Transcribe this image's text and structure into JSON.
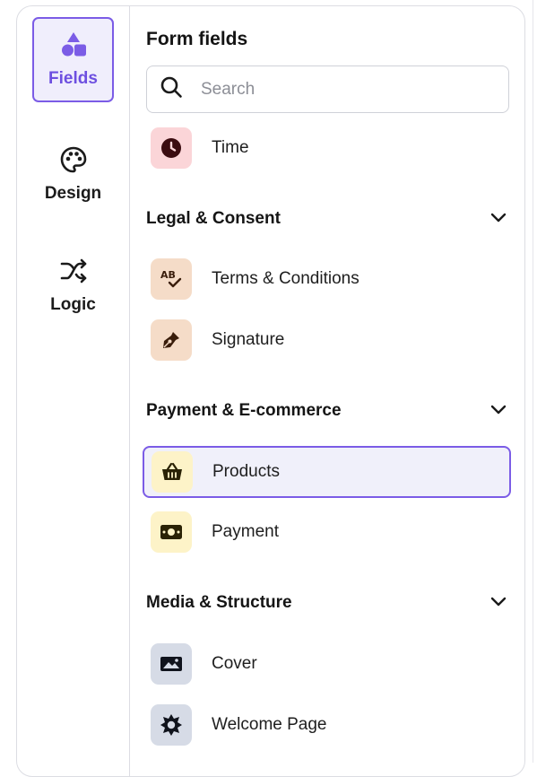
{
  "rail": {
    "items": [
      {
        "label": "Fields",
        "icon": "shapes-icon",
        "active": true
      },
      {
        "label": "Design",
        "icon": "palette-icon",
        "active": false
      },
      {
        "label": "Logic",
        "icon": "shuffle-icon",
        "active": false
      }
    ]
  },
  "panel": {
    "title": "Form fields",
    "search": {
      "placeholder": "Search",
      "value": ""
    }
  },
  "fields": {
    "time": {
      "label": "Time",
      "icon": "clock-icon",
      "color": "#fbd5d8"
    },
    "legal": {
      "title": "Legal & Consent",
      "terms": {
        "label": "Terms & Conditions",
        "icon": "spellcheck-icon",
        "color": "#f5dcc8"
      },
      "signature": {
        "label": "Signature",
        "icon": "pen-nib-icon",
        "color": "#f5dcc8"
      }
    },
    "payment": {
      "title": "Payment & E-commerce",
      "products": {
        "label": "Products",
        "icon": "basket-icon",
        "color": "#fdf3c8"
      },
      "payment": {
        "label": "Payment",
        "icon": "banknote-icon",
        "color": "#fdf3c8"
      }
    },
    "media": {
      "title": "Media & Structure",
      "cover": {
        "label": "Cover",
        "icon": "image-icon",
        "color": "#d6dbe6"
      },
      "welcome": {
        "label": "Welcome Page",
        "icon": "sun-icon",
        "color": "#d6dbe6"
      }
    }
  },
  "colors": {
    "accent": "#7b5ce6",
    "border": "#dcdde3"
  }
}
